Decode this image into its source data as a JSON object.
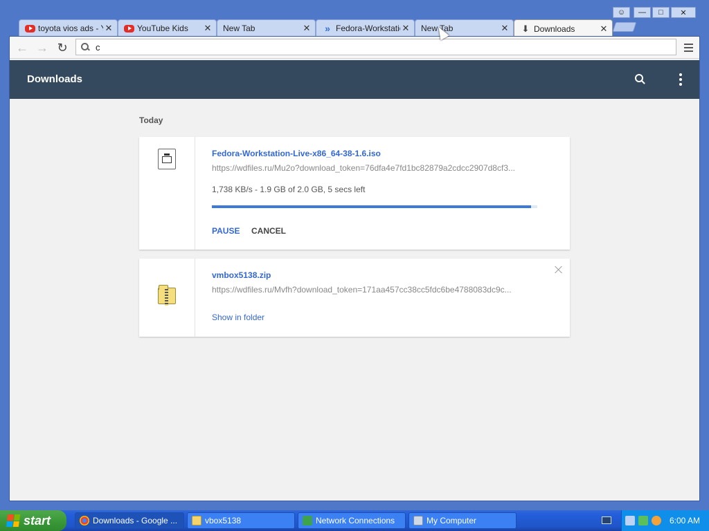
{
  "browser": {
    "tabs": [
      {
        "label": "toyota vios ads - Y",
        "icon": "youtube-icon"
      },
      {
        "label": "YouTube Kids",
        "icon": "youtube-icon"
      },
      {
        "label": "New Tab",
        "icon": ""
      },
      {
        "label": "Fedora-Workstatio",
        "icon": "fedora-icon"
      },
      {
        "label": "New Tab",
        "icon": ""
      },
      {
        "label": "Downloads",
        "icon": "download-icon",
        "active": true
      }
    ],
    "omnibox_value": "c",
    "window_controls": {
      "profile": "profile-icon",
      "minimize": "minimize-icon",
      "maximize": "maximize-icon",
      "close": "close-icon"
    }
  },
  "downloads": {
    "header_title": "Downloads",
    "date_group": "Today",
    "items": [
      {
        "filename": "Fedora-Workstation-Live-x86_64-38-1.6.iso",
        "url": "https://wdfiles.ru/Mu2o?download_token=76dfa4e7fd1bc82879a2cdcc2907d8cf3...",
        "status": "1,738 KB/s - 1.9 GB of 2.0 GB, 5 secs left",
        "progress": 0.98,
        "pause_label": "PAUSE",
        "cancel_label": "CANCEL"
      },
      {
        "filename": "vmbox5138.zip",
        "url": "https://wdfiles.ru/Mvfh?download_token=171aa457cc38cc5fdc6be4788083dc9c...",
        "show_in_folder_label": "Show in folder"
      }
    ]
  },
  "taskbar": {
    "start_label": "start",
    "tasks": [
      {
        "label": "Downloads - Google ...",
        "active": true
      },
      {
        "label": "vbox5138"
      },
      {
        "label": "Network Connections"
      },
      {
        "label": "My Computer"
      }
    ],
    "clock": "6:00 AM"
  },
  "colors": {
    "header_bg": "#34495e",
    "link_blue": "#3367d6",
    "progress_blue": "#3d7ad8",
    "xp_taskbar": "#245edb",
    "xp_start_green": "#3c9a3a"
  }
}
